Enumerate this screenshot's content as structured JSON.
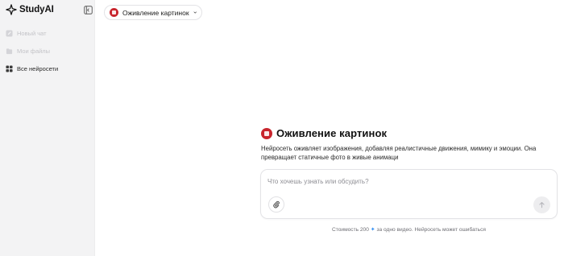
{
  "app": {
    "name": "StudyAI"
  },
  "sidebar": {
    "items": [
      {
        "label": "Новый чат",
        "icon": "edit-icon",
        "enabled": false
      },
      {
        "label": "Мои файлы",
        "icon": "folder-icon",
        "enabled": false
      },
      {
        "label": "Все нейросети",
        "icon": "grid-icon",
        "enabled": true
      }
    ]
  },
  "model_selector": {
    "label": "Оживление картинок",
    "icon": "animate-icon"
  },
  "intro": {
    "title": "Оживление картинок",
    "description": "Нейросеть оживляет изображения, добавляя реалистичные движения, мимику и эмоции. Она превращает статичные фото в живые анимаци"
  },
  "chat": {
    "placeholder": "Что хочешь узнать или обсудить?",
    "value": ""
  },
  "footer": {
    "prefix": "Стоимость 200",
    "suffix": "за одно видео. Нейросеть может ошибаться"
  },
  "colors": {
    "accent": "#c8252d",
    "token": "#2f8df2"
  }
}
